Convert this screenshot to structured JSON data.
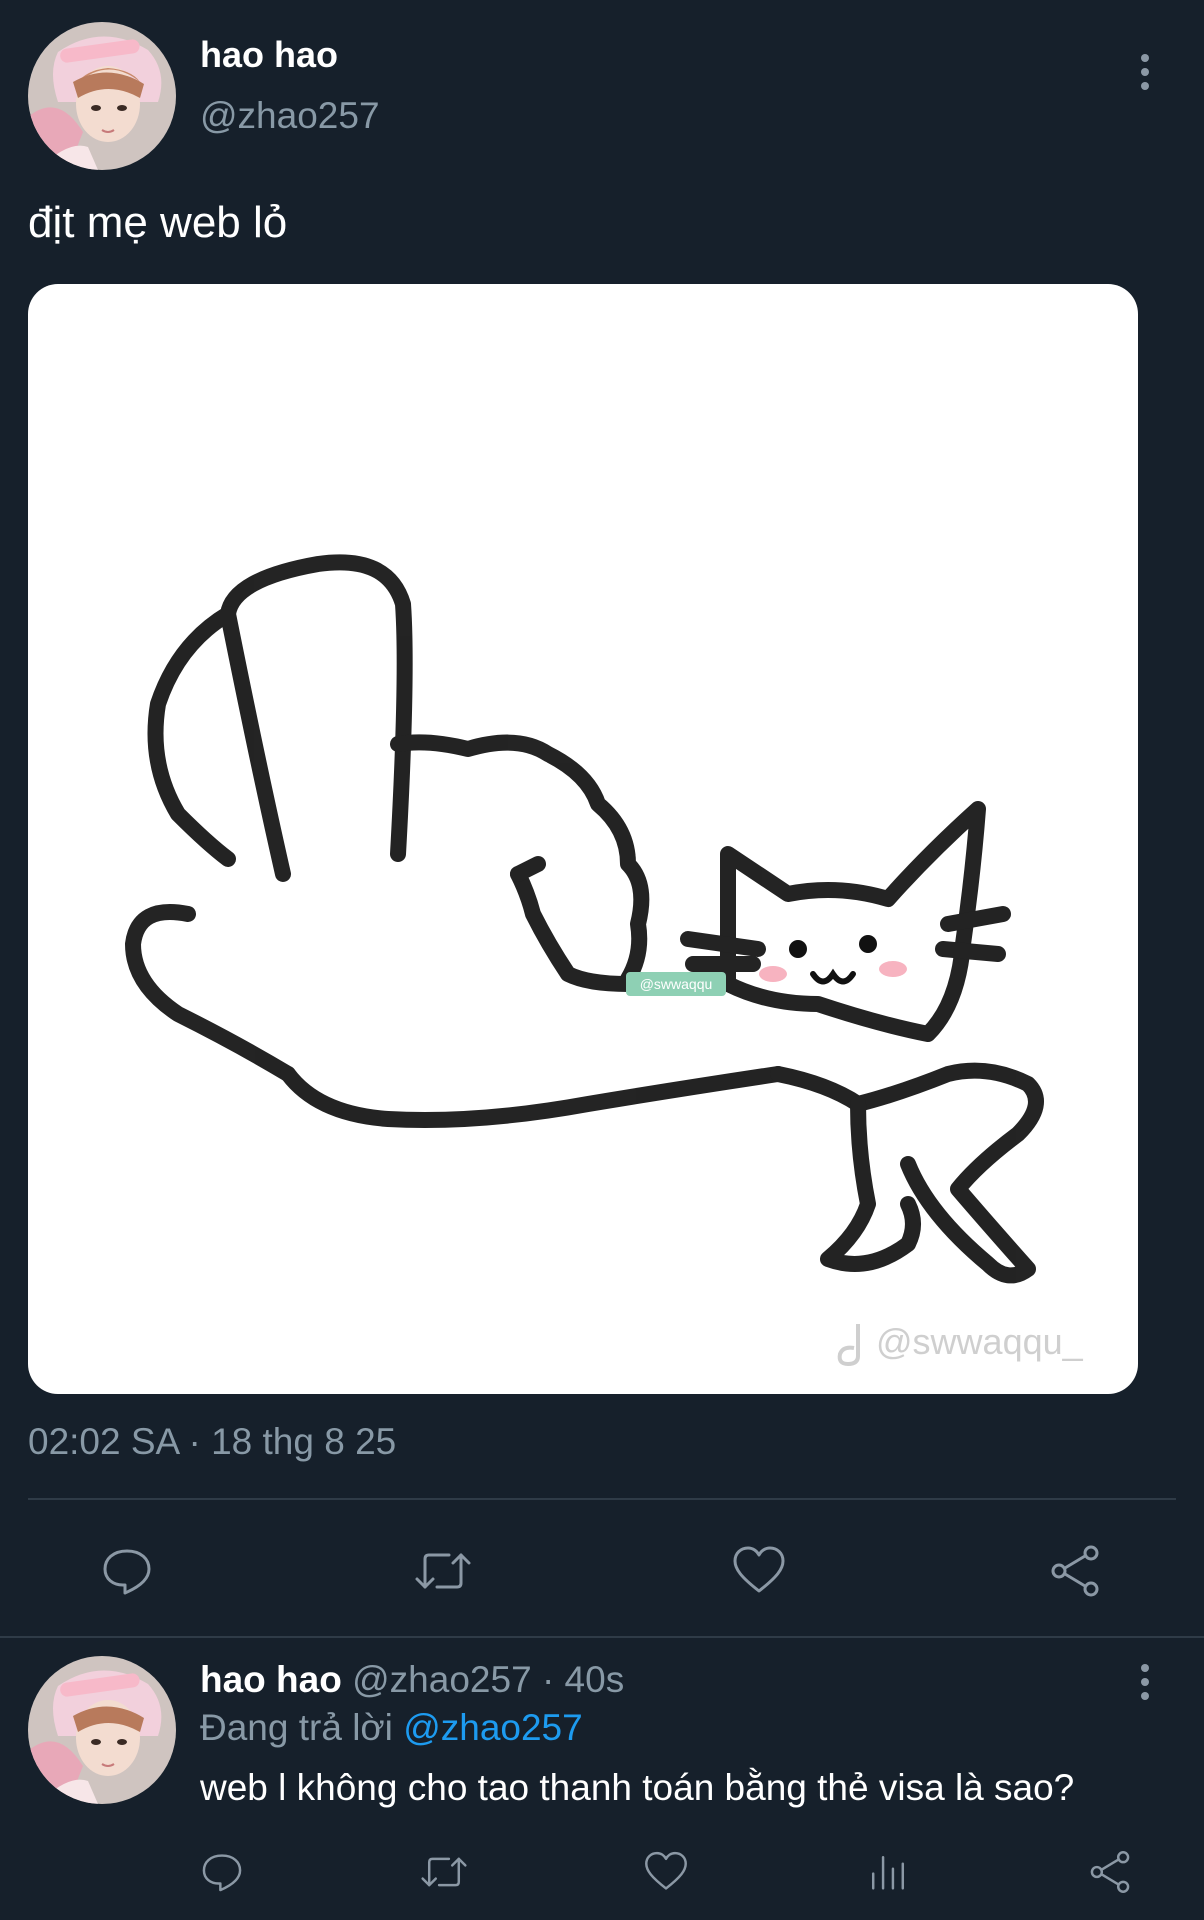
{
  "tweet": {
    "display_name": "hao hao",
    "handle": "@zhao257",
    "text": "địt mẹ web lỏ",
    "media": {
      "watermark_small": "@swwaqqu",
      "watermark": "@swwaqqu_"
    },
    "timestamp": "02:02 SA · 18 thg 8 25",
    "actions": {
      "reply_icon": "reply-icon",
      "retweet_icon": "retweet-icon",
      "like_icon": "heart-icon",
      "share_icon": "share-icon"
    }
  },
  "reply": {
    "display_name": "hao hao",
    "handle": "@zhao257",
    "time_sep": "·",
    "age": "40s",
    "replying_prefix": "Đang trả lời",
    "replying_to": "@zhao257",
    "text": "web l không cho tao thanh toán bằng thẻ visa là sao?"
  },
  "colors": {
    "background": "#16202b",
    "muted_text": "#8899a6",
    "link": "#1d9bf0",
    "divider": "#2f3b47"
  }
}
